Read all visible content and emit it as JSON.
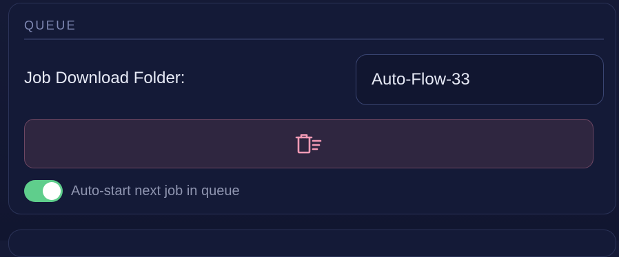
{
  "queue": {
    "section_title": "QUEUE",
    "download_folder_label": "Job Download Folder:",
    "download_folder_value": "Auto-Flow-33",
    "clear_button_icon": "trash-list-icon",
    "auto_start": {
      "label": "Auto-start next job in queue",
      "enabled": true
    }
  },
  "colors": {
    "accent_green": "#5fce8c",
    "danger_pink": "#f49ab5",
    "panel_border": "#2b3358"
  }
}
